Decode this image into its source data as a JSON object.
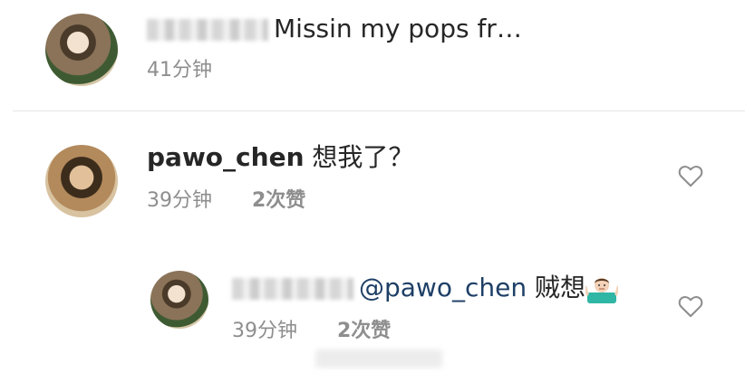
{
  "comments": [
    {
      "user": "",
      "text": "Missin my pops fr…",
      "time": "41分钟",
      "likes": ""
    },
    {
      "user": "pawo_chen",
      "text": "想我了？",
      "time": "39分钟",
      "likes": "2次赞"
    },
    {
      "user": "",
      "mention": "@pawo_chen",
      "text": "贼想",
      "time": "39分钟",
      "likes": "2次赞"
    }
  ],
  "colors": {
    "text": "#262626",
    "meta": "#8e8e8e",
    "mention": "#1e3f66",
    "heart": "#8e8e8e"
  },
  "icons": {
    "heart": "heart-outline-icon",
    "emoji": "person-shrugging-emoji"
  }
}
